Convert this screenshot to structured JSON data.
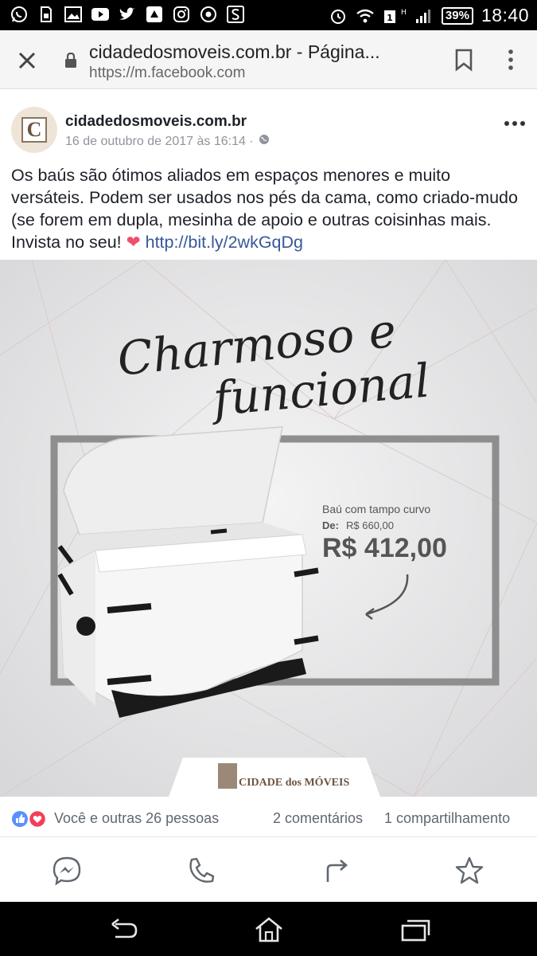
{
  "status_bar": {
    "battery": "39%",
    "time": "18:40",
    "network": "H"
  },
  "browser": {
    "title": "cidadedosmoveis.com.br - Página...",
    "url_scheme": "https://",
    "url_host": "m.facebook.com"
  },
  "post": {
    "page_name": "cidadedosmoveis.com.br",
    "avatar_letter": "C",
    "timestamp": "16 de outubro de 2017 às 16:14 ·",
    "text": "Os baús são ótimos aliados em espaços menores e muito versáteis. Podem ser usados nos pés da cama, como criado-mudo (se forem em dupla, mesinha de apoio e outras coisinhas mais. Invista no seu!",
    "link": "http://bit.ly/2wkGqDg"
  },
  "ad_image": {
    "headline_line1": "Charmoso e",
    "headline_line2": "funcional",
    "product_name": "Baú com tampo curvo",
    "old_price_label": "De:",
    "old_price": "R$ 660,00",
    "price": "R$ 412,00",
    "brand_logo_text": "CIDADE dos MÓVEIS",
    "colors": {
      "background": "#e3e3e4",
      "frame": "#8e8e8e",
      "chest": "#f4f4f4",
      "hardware": "#1a1a1a"
    }
  },
  "engagement": {
    "reactions_label": "Você e outras 26 pessoas",
    "comments": "2 comentários",
    "shares": "1 compartilhamento"
  },
  "actions": [
    "messenger-icon",
    "phone-icon",
    "share-icon",
    "star-icon"
  ],
  "nav": [
    "back-icon",
    "home-icon",
    "recents-icon"
  ]
}
